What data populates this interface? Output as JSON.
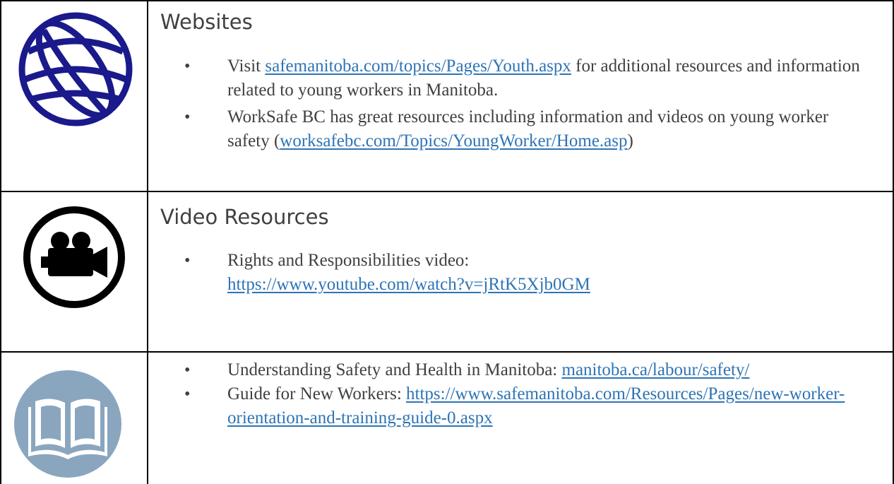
{
  "rows": [
    {
      "icon": "globe-icon",
      "heading": "Websites",
      "items": [
        {
          "pre": "Visit ",
          "link": "safemanitoba.com/topics/Pages/Youth.aspx",
          "post": " for additional resources and information related to young workers in Manitoba."
        },
        {
          "pre": "WorkSafe BC has great resources including information and videos on young worker safety (",
          "link": "worksafebc.com/Topics/YoungWorker/Home.asp",
          "post": ")"
        }
      ]
    },
    {
      "icon": "video-camera-icon",
      "heading": "Video Resources",
      "items": [
        {
          "pre": "Rights and Responsibilities video: ",
          "link": "https://www.youtube.com/watch?v=jRtK5Xjb0GM",
          "post": ""
        }
      ]
    },
    {
      "icon": "book-icon",
      "heading": "",
      "items": [
        {
          "pre": "Understanding Safety and Health in Manitoba: ",
          "link": "manitoba.ca/labour/safety/",
          "post": ""
        },
        {
          "pre": "Guide for New Workers: ",
          "link": "https://www.safemanitoba.com/Resources/Pages/new-worker-orientation-and-training-guide-0.aspx",
          "post": ""
        }
      ]
    }
  ],
  "colors": {
    "link": "#2e74b5",
    "text": "#404040",
    "globe": "#1a1a8c",
    "book_circle": "#8aa6bf"
  }
}
